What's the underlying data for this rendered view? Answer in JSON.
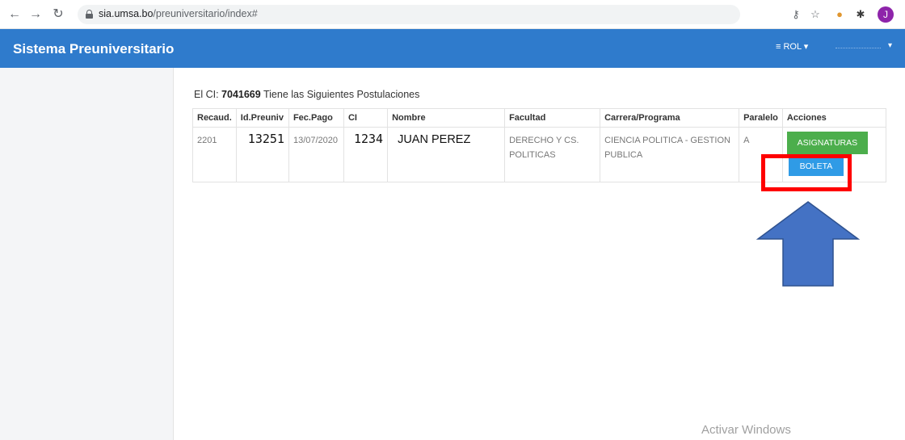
{
  "browser": {
    "back_icon": "arrow-left-icon",
    "forward_icon": "arrow-right-icon",
    "reload_icon": "reload-icon",
    "url_host": "sia.umsa.bo",
    "url_path": "/preuniversitario/index#",
    "profile_initial": "J"
  },
  "header": {
    "title": "Sistema Preuniversitario",
    "rol_label": "≡ ROL ▾",
    "user_caret": "▾",
    "color": "#2f7bcc"
  },
  "info": {
    "prefix": "El CI: ",
    "ci": "7041669",
    "suffix": " Tiene las Siguientes Postulaciones"
  },
  "table": {
    "headers": [
      "Recaud.",
      "Id.Preuniv",
      "Fec.Pago",
      "CI",
      "Nombre",
      "Facultad",
      "Carrera/Programa",
      "Paralelo",
      "Acciones"
    ],
    "rows": [
      {
        "recaud": "2201",
        "id_preuniv": "13251",
        "fec_pago": "13/07/2020",
        "ci": "1234",
        "nombre": "JUAN PEREZ",
        "facultad": "DERECHO Y CS. POLITICAS",
        "carrera": "CIENCIA POLITICA - GESTION PUBLICA",
        "paralelo": "A",
        "btn_asignaturas": "ASIGNATURAS",
        "btn_boleta": "BOLETA"
      }
    ]
  },
  "colors": {
    "asignaturas_button": "#4cae4c",
    "boleta_button": "#2f9be6",
    "highlight": "#ff0000",
    "arrow": "#4472c4"
  },
  "watermark": "Activar Windows"
}
